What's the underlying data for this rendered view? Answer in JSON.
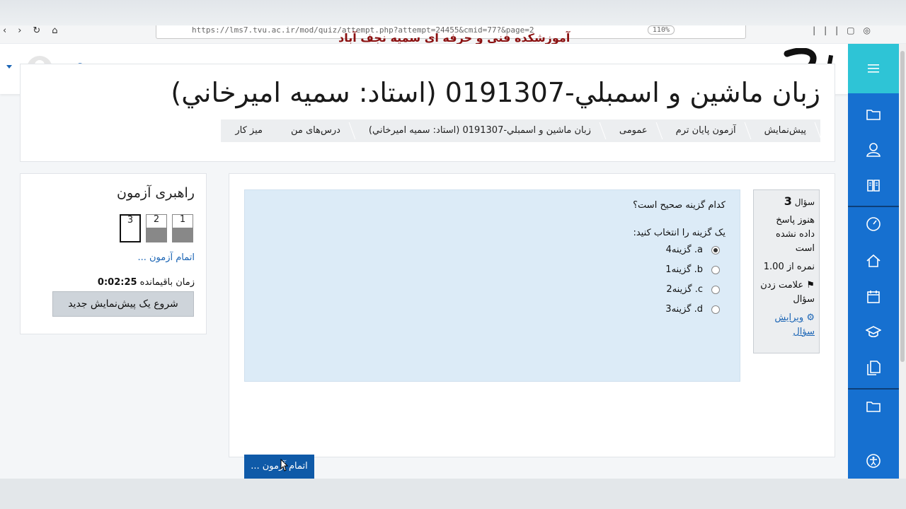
{
  "browser": {
    "url": "https://lms7.tvu.ac.ir/mod/quiz/attempt.php?attempt=24455&cmid=77?&page=2",
    "zoom": "110%"
  },
  "watermark": "آموزشکده فنی و حرفه ای سمیه نجف آباد",
  "course": {
    "title": "زبان ماشين و اسمبلي-0191307 (استاد: سميه اميرخاني)"
  },
  "breadcrumb": [
    "ميز کار",
    "درس‌های من",
    "زبان ماشين و اسمبلي-0191307 (استاد: سميه اميرخاني)",
    "عمومی",
    "آزمون پایان ترم",
    "پیش‌نمایش"
  ],
  "quiz_nav": {
    "title": "راهبری آزمون",
    "questions": [
      "1",
      "2",
      "3"
    ],
    "current": "3",
    "finish_link": "اتمام آزمون ...",
    "time_label": "زمان باقیمانده",
    "time_value": "0:02:25",
    "new_preview": "شروع یک پیش‌نمایش جدید"
  },
  "question_info": {
    "label": "سؤال",
    "number": "3",
    "status": "هنوز پاسخ داده نشده است",
    "grade": "نمره از 1.00",
    "flag": "علامت زدن سؤال",
    "edit": "ویرایش سؤال"
  },
  "question": {
    "text": "کدام گزینه صحیح است؟",
    "prompt": "یک گزینه را انتخاب کنید:",
    "options": [
      {
        "letter": "a.",
        "label": "گزینه4",
        "checked": true
      },
      {
        "letter": "b.",
        "label": "گزینه1",
        "checked": false
      },
      {
        "letter": "c.",
        "label": "گزینه2",
        "checked": false
      },
      {
        "letter": "d.",
        "label": "گزینه3",
        "checked": false
      }
    ]
  },
  "finish_button": "اتمام آزمون ...",
  "colors": {
    "sidebar": "#1670d0",
    "sidebar_top": "#2ec4d6",
    "question_bg": "#dcebf7",
    "finish_button": "#0f5aa8",
    "watermark": "#8b1111"
  }
}
